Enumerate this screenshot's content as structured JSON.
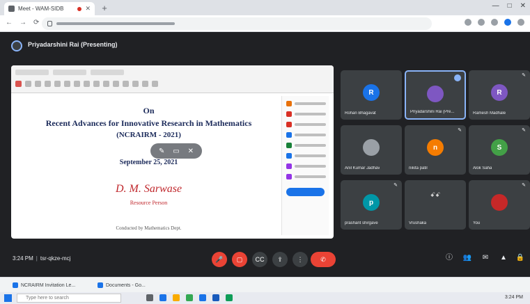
{
  "browser": {
    "tab_title": "Meet - WAM-SIDB",
    "url": "meet.google.com/tsr-qkze-mcj?authuser=0",
    "window_controls": [
      "—",
      "□",
      "✕"
    ]
  },
  "meet": {
    "presenter_label": "Priyadarshini Rai (Presenting)",
    "time": "3:24 PM",
    "meeting_code": "tsr-qkze-mcj"
  },
  "presentation": {
    "on": "On",
    "title1": "Recent Advances for Innovative Research in Mathematics",
    "title2": "(NCRAIRM - 2021)",
    "date": "September 25, 2021",
    "speaker": "D. M. Sarwase",
    "affiliation": "Resource Person",
    "footer": "Conducted by Mathematics Dept."
  },
  "participants": [
    {
      "name": "Rohan Bhagavat",
      "initial": "R",
      "color": "#1a73e8"
    },
    {
      "name": "Priyadarshini Rai (Pre...",
      "initial": "",
      "color": "#7e57c2"
    },
    {
      "name": "Ramesh Madhale",
      "initial": "R",
      "color": "#7e57c2"
    },
    {
      "name": "Anil Kumar Jadhav",
      "initial": "",
      "color": "#9aa0a6"
    },
    {
      "name": "nikita patil",
      "initial": "n",
      "color": "#f57c00"
    },
    {
      "name": "Alok Saha",
      "initial": "S",
      "color": "#43a047"
    },
    {
      "name": "prashant shirgave",
      "initial": "p",
      "color": "#0097a7"
    },
    {
      "name": "Vrushaka",
      "initial": "",
      "color": "#5f6368"
    },
    {
      "name": "You",
      "initial": "",
      "color": "#c62828"
    }
  ],
  "taskbar": {
    "search_placeholder": "Type here to search",
    "bottom_tabs": [
      "NCRAIRM Invitation Le...",
      "Documents - Go..."
    ],
    "tray_time": "3:24 PM"
  },
  "icons": {
    "tab_close": "✕",
    "new_tab": "+",
    "nav": [
      "←",
      "→",
      "⟳"
    ],
    "mic": "🎤",
    "camera": "▢",
    "captions": "CC",
    "present": "⇪",
    "more": "⋮",
    "end_call": "✆",
    "info": "ⓘ",
    "people": "👥",
    "chat": "✉",
    "activities": "▲",
    "lock": "🔒"
  }
}
